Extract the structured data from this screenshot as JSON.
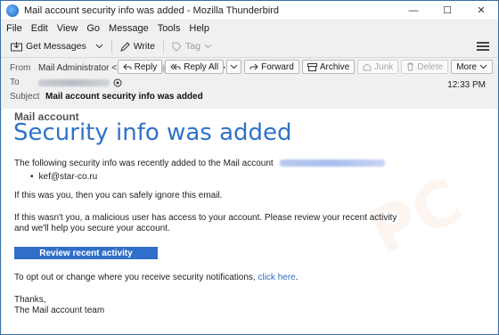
{
  "window": {
    "title": "Mail account security info was added - Mozilla Thunderbird",
    "minimize": "—",
    "maximize": "☐",
    "close": "✕"
  },
  "menu": [
    "File",
    "Edit",
    "View",
    "Go",
    "Message",
    "Tools",
    "Help"
  ],
  "toolbar": {
    "get_messages": "Get Messages",
    "write": "Write",
    "tag": "Tag"
  },
  "actions": {
    "reply": "Reply",
    "reply_all": "Reply All",
    "forward": "Forward",
    "archive": "Archive",
    "junk": "Junk",
    "delete": "Delete",
    "more": "More"
  },
  "header": {
    "from_label": "From",
    "from_name": "Mail Administrator <",
    "from_end": ">",
    "to_label": "To",
    "subject_label": "Subject",
    "subject": "Mail account security info was added",
    "time": "12:33 PM"
  },
  "message": {
    "brand": "Mail account",
    "headline": "Security info was added",
    "intro": "The following security info was recently added to the Mail account",
    "bullet": "kef@star-co.ru",
    "p1": "If this was you, then you can safely ignore this email.",
    "p2a": "If this wasn't you, a malicious user has access to your account. Please review your recent activity",
    "p2b": "and we'll help you secure your account.",
    "button": "Review recent activity",
    "optout_prefix": "To opt out or change where you receive security notifications, ",
    "optout_link": "click here",
    "optout_suffix": ".",
    "thanks": "Thanks,",
    "signature": "The Mail account team"
  }
}
